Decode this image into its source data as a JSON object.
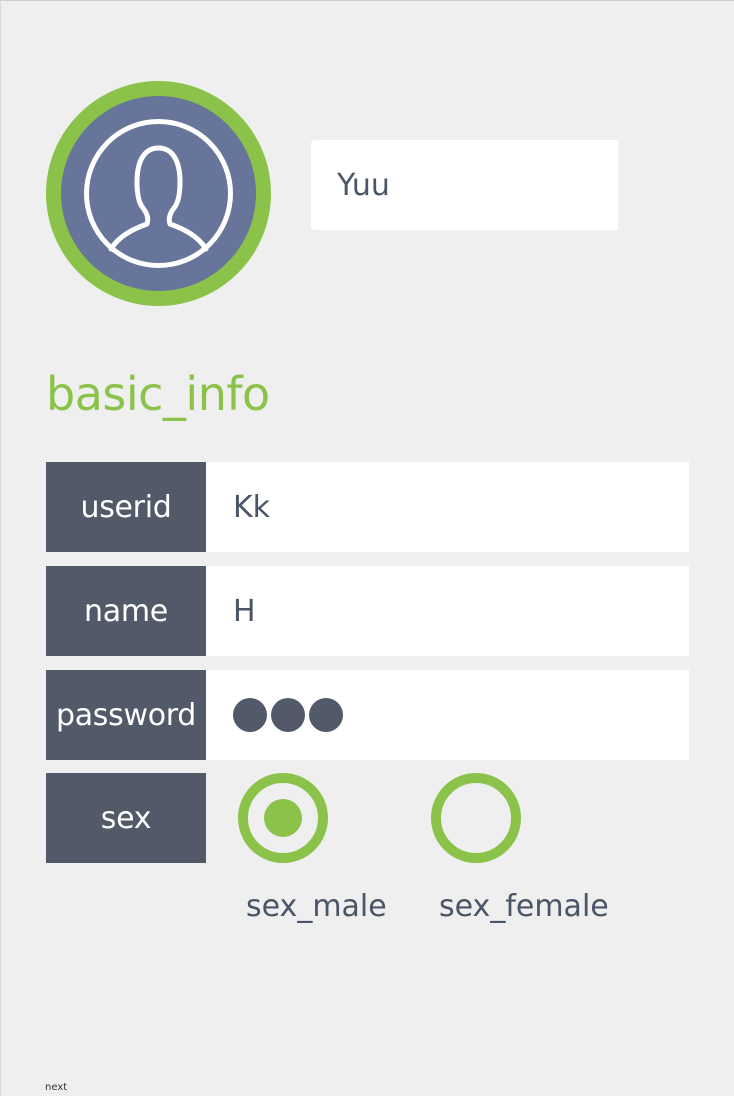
{
  "profile": {
    "nickname": "Yuu",
    "avatar_icon": "user-silhouette-icon",
    "accent_color": "#8bc34a",
    "avatar_bg_color": "#68759a"
  },
  "section_title": "basic_info",
  "fields": {
    "userid": {
      "label": "userid",
      "value": "Kk"
    },
    "name": {
      "label": "name",
      "value": "H"
    },
    "password": {
      "label": "password",
      "masked_length": 3
    },
    "sex": {
      "label": "sex",
      "options": [
        {
          "label": "sex_male",
          "selected": true
        },
        {
          "label": "sex_female",
          "selected": false
        }
      ]
    }
  },
  "footer": {
    "next_label": "next"
  }
}
